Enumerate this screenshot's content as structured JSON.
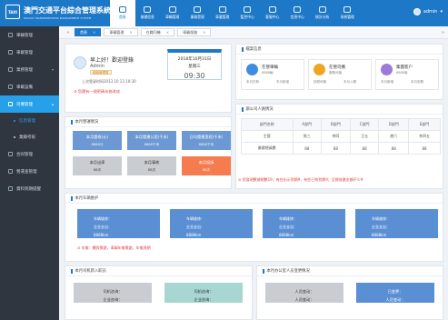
{
  "header": {
    "logo_text": "TAXI",
    "title": "澳門交通平台綜合管理系統",
    "subtitle": "MACAO TRANSPORTATION MANAGEMENT SYSTEM",
    "user_name": "admin"
  },
  "nav": [
    {
      "label": "首頁",
      "icon": "home-icon",
      "active": true
    },
    {
      "label": "基礎信息",
      "icon": "info-icon"
    },
    {
      "label": "車輛管理",
      "icon": "car-icon"
    },
    {
      "label": "業務受理",
      "icon": "business-icon"
    },
    {
      "label": "車載管理",
      "icon": "onboard-icon"
    },
    {
      "label": "監控中心",
      "icon": "monitor-icon"
    },
    {
      "label": "客服中心",
      "icon": "service-icon"
    },
    {
      "label": "信息中心",
      "icon": "message-icon"
    },
    {
      "label": "統計分析",
      "icon": "chart-icon"
    },
    {
      "label": "系統管理",
      "icon": "settings-icon"
    }
  ],
  "sidebar": {
    "items": [
      {
        "label": "車輛管理"
      },
      {
        "label": "車載管理"
      },
      {
        "label": "業務管理",
        "has_arrow": true
      },
      {
        "label": "車載設備"
      },
      {
        "label": "司機管理",
        "open": true,
        "subitems": [
          {
            "label": "信息管理",
            "active": true
          },
          {
            "label": "業績考核"
          }
        ]
      },
      {
        "label": "合同管理"
      },
      {
        "label": "營運查管理"
      },
      {
        "label": "資料到期提醒"
      }
    ]
  },
  "tabs": {
    "items": [
      {
        "label": "首頁",
        "active": true
      },
      {
        "label": "車輛管理"
      },
      {
        "label": "在職司機"
      },
      {
        "label": "車輛保險"
      }
    ]
  },
  "welcome": {
    "greeting": "早上好！歡迎登錄",
    "user": "Admin",
    "role_badge": "超級管理員",
    "last_login": "上次登录时间2013 10 13 10:30",
    "warning": "您還有一個密碼未修改成",
    "date_line1": "2018年10月31日",
    "date_line2": "星期三",
    "time": "09:30"
  },
  "monthly": {
    "title": "本月營運情況",
    "cards": [
      {
        "label": "本月營收(元)",
        "value": "8888元",
        "style": "blue"
      },
      {
        "label": "本月營運公里(千米)",
        "value": "8888千米",
        "style": "blue"
      },
      {
        "label": "日均營運里程(千米)",
        "value": "8888千米",
        "style": "blue"
      },
      {
        "label": "本月出車",
        "value": "88次",
        "style": "grey"
      },
      {
        "label": "本月事故",
        "value": "88次",
        "style": "grey"
      },
      {
        "label": "本月投訴",
        "value": "88次",
        "style": "orange"
      }
    ]
  },
  "enterprise": {
    "title": "檔案信息",
    "cards": [
      {
        "title": "在營車輛",
        "sub": "8888輛",
        "bottom_left": "本月在冊",
        "bottom_right": "本月新增",
        "color": "#3f8de0"
      },
      {
        "title": "在營司機",
        "sub": "服務司機",
        "bottom_left": "持照司機",
        "bottom_right": "本月入職",
        "color": "#f0a623"
      },
      {
        "title": "集團客户",
        "sub": "8888個",
        "bottom_left": "本月新增",
        "bottom_right": "本月到期",
        "color": "#9b7ad8"
      }
    ]
  },
  "office": {
    "title": "辦公司人員情況",
    "header": [
      "部門名称",
      "A部門",
      "B部門",
      "C部門",
      "D部門",
      "E部門"
    ],
    "rows": [
      [
        "主管",
        "張三",
        "李四",
        "王五",
        "趙六",
        "李四五"
      ],
      [
        "業績總員數",
        "88",
        "88",
        "88",
        "88",
        "88"
      ]
    ],
    "warning": "您發現數據總數19；有些出示到期9，有些已快到期9；至總效產金額不少9"
  },
  "maintenance": {
    "title": "本月车辆维护",
    "cards": [
      {
        "line1": "车辆维修：",
        "line2": "企业支出：",
        "line3": "8888km"
      },
      {
        "line1": "车辆维修：",
        "line2": "企业支出：",
        "line3": "8888km"
      },
      {
        "line1": "车辆维修：",
        "line2": "企业支出：",
        "line3": "8888km"
      },
      {
        "line1": "车辆维修：",
        "line2": "企业支出：",
        "line3": "8888km"
      }
    ],
    "warning": "年檢：續保需處，車輛年檢需處，年檢過期"
  },
  "drivers": {
    "title": "本月司机新入职员",
    "cards": [
      {
        "line1": "司机咨询：",
        "line2": "企业咨询：",
        "color": "#c9ccd1"
      },
      {
        "line1": "司机咨询：",
        "line2": "企业咨询：",
        "color": "#a8d6d2"
      }
    ]
  },
  "office_complaints": {
    "title": "本月办公室人员变更情况",
    "cards": [
      {
        "line1": "人员变动：",
        "line2": "人员变动：",
        "color": "#c9ccd1"
      },
      {
        "line1": "已变更：",
        "line2": "人员变动：",
        "color": "#5a8fd3"
      }
    ]
  }
}
